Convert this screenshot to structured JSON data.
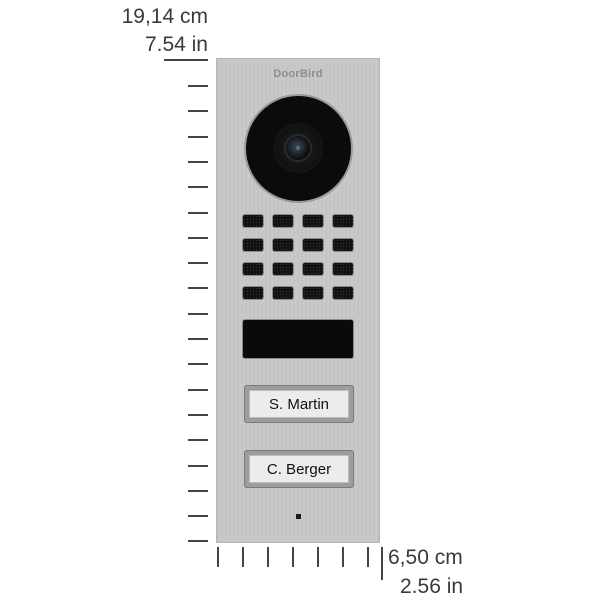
{
  "dimensions": {
    "height_cm": "19,14 cm",
    "height_in": "7.54 in",
    "width_cm": "6,50 cm",
    "width_in": "2.56 in"
  },
  "device": {
    "brand": "DoorBird",
    "keypad_slots": 16,
    "buttons": [
      {
        "label": "S. Martin"
      },
      {
        "label": "C. Berger"
      }
    ]
  },
  "colors": {
    "plate": "#c6c6c6",
    "ruler": "#444444",
    "text": "#3a3a3a"
  }
}
